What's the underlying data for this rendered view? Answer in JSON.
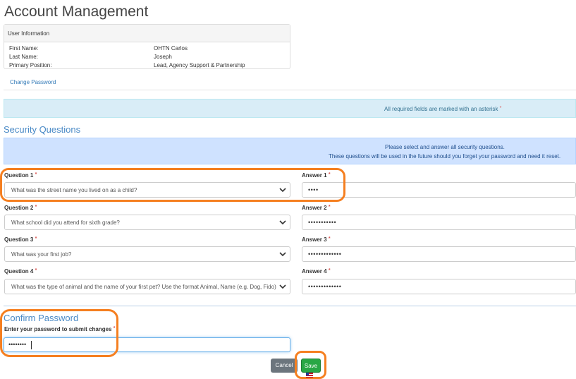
{
  "page": {
    "title": "Account Management"
  },
  "user_info": {
    "heading": "User Information",
    "rows": [
      {
        "label": "First Name:",
        "value": "OHTN Carlos"
      },
      {
        "label": "Last Name:",
        "value": "Joseph"
      },
      {
        "label": "Primary Position:",
        "value": "Lead, Agency Support & Partnership"
      }
    ]
  },
  "links": {
    "change_password": "Change Password"
  },
  "required_note": {
    "text": "All required fields are marked with an asterisk",
    "asterisk": "*"
  },
  "security": {
    "title": "Security Questions",
    "note_line1": "Please select and answer all security questions.",
    "note_line2": "These questions will be used in the future should you forget your password and need it reset.",
    "questions": [
      {
        "label": "Question 1",
        "selected": "What was the street name you lived on as a child?",
        "answer_label": "Answer 1",
        "answer_mask": "••••"
      },
      {
        "label": "Question 2",
        "selected": "What school did you attend for sixth grade?",
        "answer_label": "Answer 2",
        "answer_mask": "•••••••••••"
      },
      {
        "label": "Question 3",
        "selected": "What was your first job?",
        "answer_label": "Answer 3",
        "answer_mask": "•••••••••••••"
      },
      {
        "label": "Question 4",
        "selected": "What was the type of animal and the name of your first pet? Use the format Animal, Name (e.g. Dog, Fido)",
        "answer_label": "Answer 4",
        "answer_mask": "•••••••••••••"
      }
    ]
  },
  "confirm": {
    "title": "Confirm Password",
    "label": "Enter your password to submit changes",
    "mask": "••••••••"
  },
  "buttons": {
    "cancel": "Cancel",
    "save": "Save"
  },
  "colors": {
    "highlight": "#f57f20",
    "link": "#337ab7",
    "save": "#28a745",
    "cancel": "#6c757d",
    "section_title": "#4a8ac6"
  },
  "icons": {
    "select_arrow": "chevron-down-icon",
    "pointer": "cursor-icon"
  }
}
